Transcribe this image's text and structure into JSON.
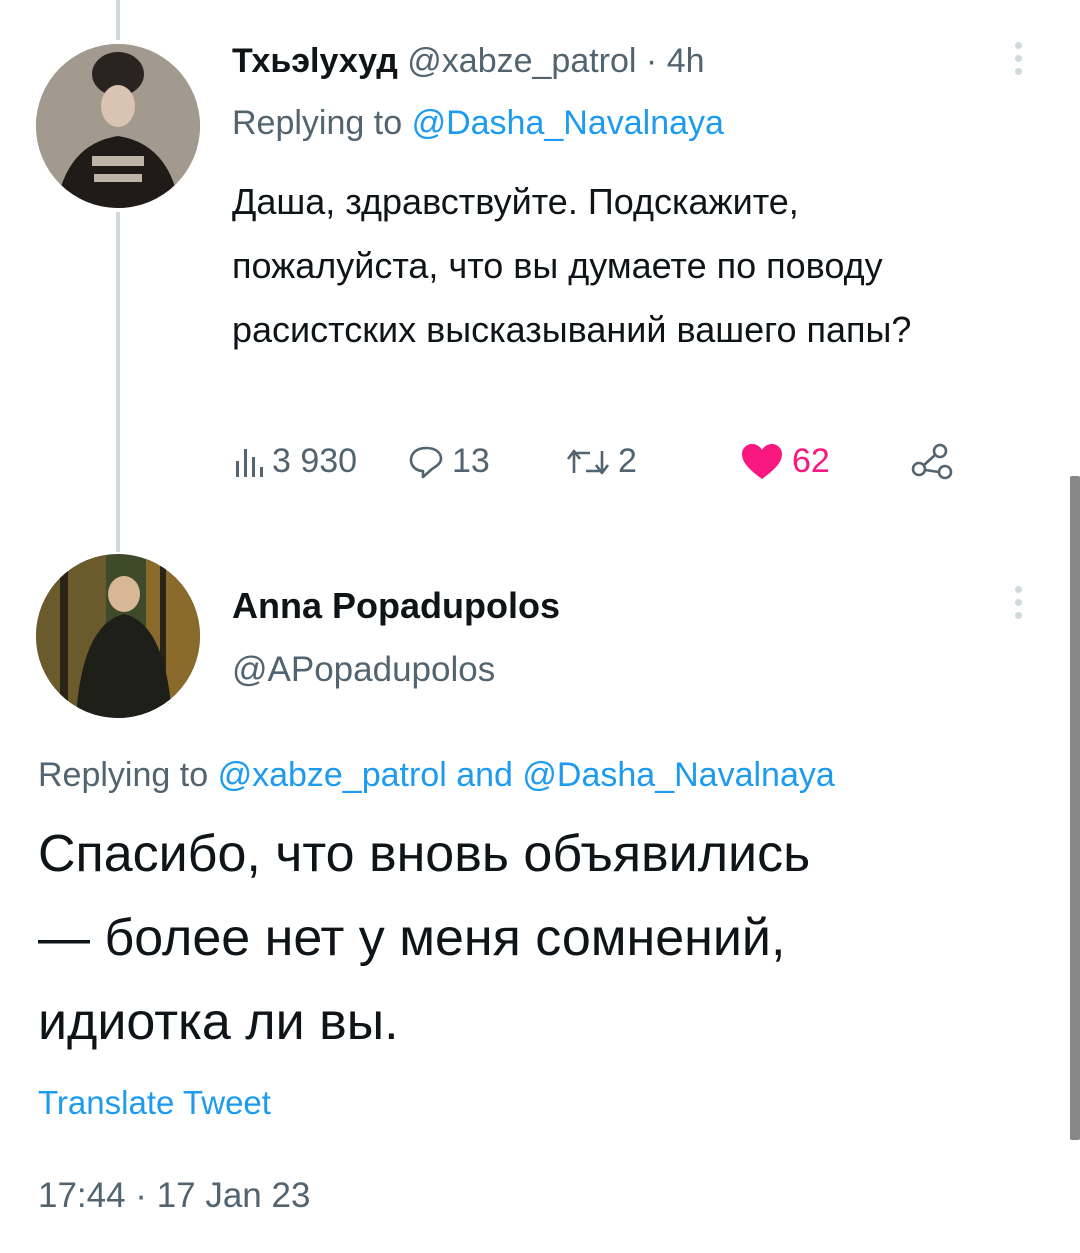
{
  "reply": {
    "author_name": "Тхьэlухуд",
    "handle": "@xabze_patrol",
    "separator": "·",
    "time": "4h",
    "replying_prefix": "Replying to",
    "replying_to": "@Dasha_Navalnaya",
    "text": "Даша, здравствуйте. Подскажите, пожалуйста, что вы думаете по поводу расистских высказываний вашего папы?",
    "views": "3 930",
    "replies": "13",
    "retweets": "2",
    "likes": "62",
    "like_color": "#f91880"
  },
  "main": {
    "author_name": "Anna Popadupolos",
    "handle": "@APopadupolos",
    "replying_prefix": "Replying to",
    "replying_to_1": "@xabze_patrol",
    "replying_and": "and",
    "replying_to_2": "@Dasha_Navalnaya",
    "text_line1": "Спасибо, что вновь объявились",
    "text_line2": "— более нет у меня сомнений,",
    "text_line3": "идиотка ли вы.",
    "translate": "Translate Tweet",
    "timestamp": "17:44 · 17 Jan 23"
  },
  "colors": {
    "accent": "#1d9bf0",
    "muted": "#536471",
    "like": "#f91880"
  }
}
